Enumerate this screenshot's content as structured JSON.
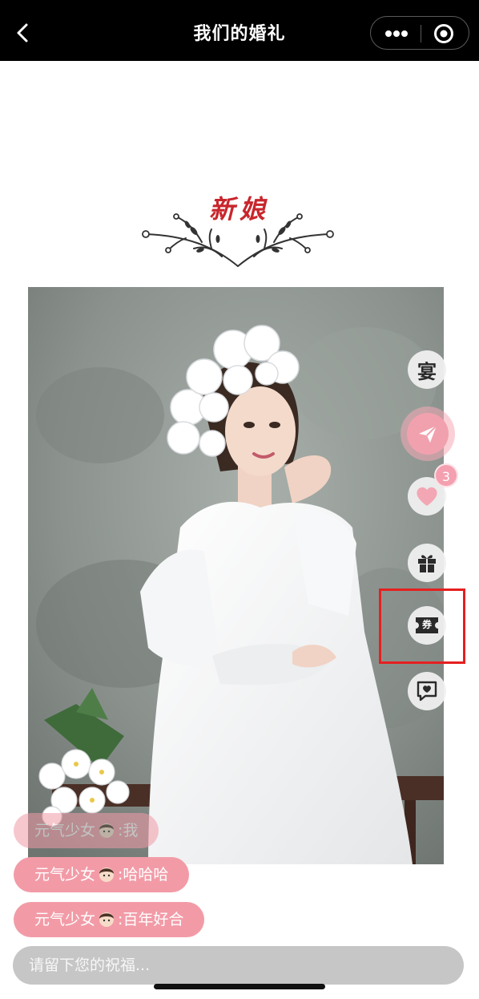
{
  "nav": {
    "title": "我们的婚礼"
  },
  "section": {
    "title": "新娘"
  },
  "side_actions": {
    "banquet_label": "宴",
    "like_count": "3",
    "coupon_label": "券"
  },
  "messages": [
    {
      "user": "元气少女",
      "text": ":我"
    },
    {
      "user": "元气少女",
      "text": ":哈哈哈"
    },
    {
      "user": "元气少女",
      "text": ":百年好合"
    }
  ],
  "input": {
    "placeholder": "请留下您的祝福..."
  },
  "colors": {
    "accent_pink": "#f29ba7",
    "title_red": "#c8262c",
    "highlight_red": "#e52020"
  },
  "icons": [
    "back-icon",
    "more-icon",
    "close-icon",
    "send-icon",
    "heart-icon",
    "gift-icon",
    "coupon-icon",
    "comment-heart-icon",
    "girl-emoji-icon"
  ]
}
